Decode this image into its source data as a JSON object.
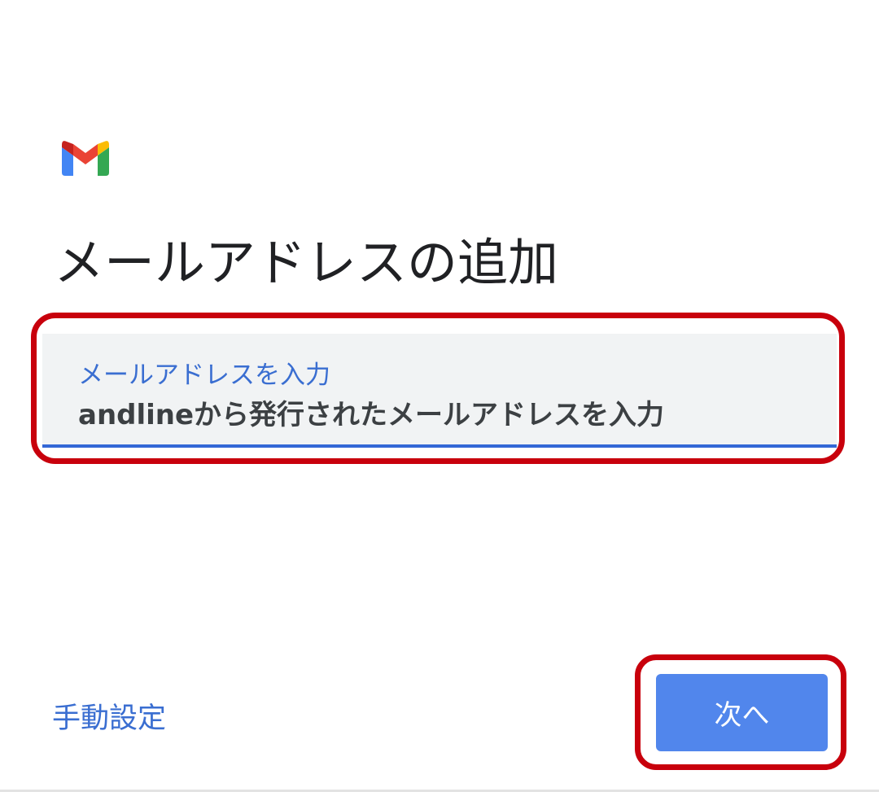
{
  "header": {
    "logo_icon": "gmail-icon",
    "title": "メールアドレスの追加"
  },
  "email_field": {
    "label": "メールアドレスを入力",
    "value": "andlineから発行されたメールアドレスを入力"
  },
  "footer": {
    "manual_setup_label": "手動設定",
    "next_button_label": "次へ"
  },
  "colors": {
    "accent_blue": "#3a6ed1",
    "button_blue": "#5186ec",
    "highlight_red": "#c8000c",
    "field_background": "#f1f3f4"
  }
}
